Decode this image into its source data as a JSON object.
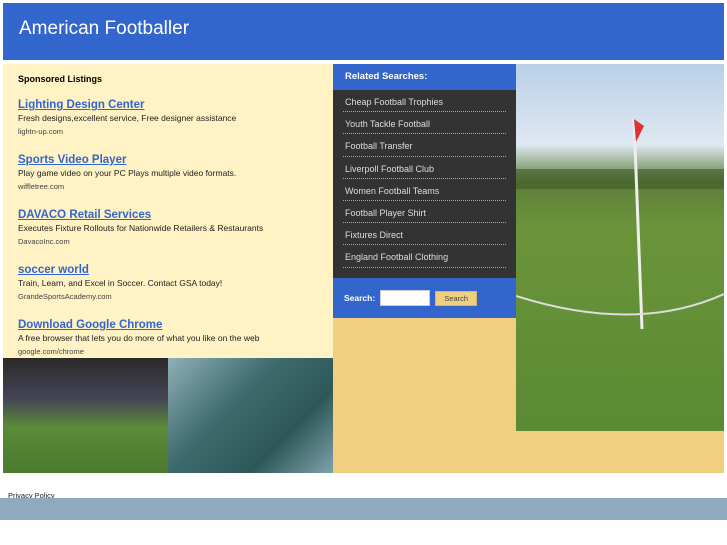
{
  "header": {
    "title": "American Footballer"
  },
  "sponsored": {
    "heading": "Sponsored Listings",
    "ads": [
      {
        "title": "Lighting Design Center",
        "desc": "Fresh designs,excellent service, Free designer assistance",
        "url": "lightn-up.com"
      },
      {
        "title": "Sports Video Player",
        "desc": "Play game video on your PC Plays multiple video formats.",
        "url": "wiffletree.com"
      },
      {
        "title": "DAVACO Retail Services",
        "desc": "Executes Fixture Rollouts for Nationwide Retailers & Restaurants",
        "url": "DavacoInc.com"
      },
      {
        "title": "soccer world",
        "desc": "Train, Learn, and Excel in Soccer. Contact GSA today!",
        "url": "GrandeSportsAcademy.com"
      },
      {
        "title": "Download Google Chrome",
        "desc": "A free browser that lets you do more of what you like on the web",
        "url": "google.com/chrome"
      }
    ]
  },
  "related": {
    "heading": "Related Searches:",
    "items": [
      "Cheap Football Trophies",
      "Youth Tackle Football",
      "Football Transfer",
      "Liverpoll Football Club",
      "Women Football Teams",
      "Football Player Shirt",
      "Fixtures Direct",
      "England Football Clothing"
    ]
  },
  "search": {
    "label": "Search:",
    "value": "",
    "button": "Search"
  },
  "footer": {
    "privacy": "Privacy Policy"
  },
  "colors": {
    "header": "#3366cc",
    "cream": "#fff2c4",
    "tan": "#f1cf80",
    "dark": "#333333",
    "footer_bar": "#8eaabf",
    "link": "#3366cc"
  }
}
